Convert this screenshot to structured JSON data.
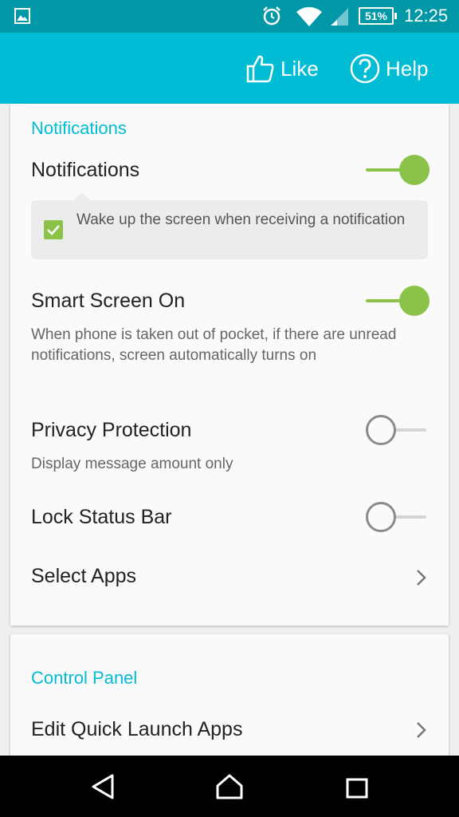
{
  "status_bar": {
    "battery": "51%",
    "time": "12:25"
  },
  "app_bar": {
    "like_label": "Like",
    "help_label": "Help"
  },
  "notifications_section": {
    "header": "Notifications",
    "notifications": {
      "title": "Notifications",
      "enabled": true,
      "wake_option": {
        "label": "Wake up the screen when receiving a notification",
        "checked": true
      }
    },
    "smart_screen": {
      "title": "Smart Screen On",
      "subtitle": "When phone is taken out of pocket, if there are unread notifications, screen automatically turns on",
      "enabled": true
    },
    "privacy": {
      "title": "Privacy Protection",
      "subtitle": "Display message amount only",
      "enabled": false
    },
    "lock_status_bar": {
      "title": "Lock Status Bar",
      "enabled": false
    },
    "select_apps": {
      "title": "Select Apps"
    }
  },
  "control_panel_section": {
    "header": "Control Panel",
    "edit_quick_launch": {
      "title": "Edit Quick Launch Apps"
    }
  },
  "colors": {
    "status_bar": "#0097a7",
    "app_bar": "#00bcd4",
    "accent": "#00bcd4",
    "switch_on": "#8bc34a"
  }
}
